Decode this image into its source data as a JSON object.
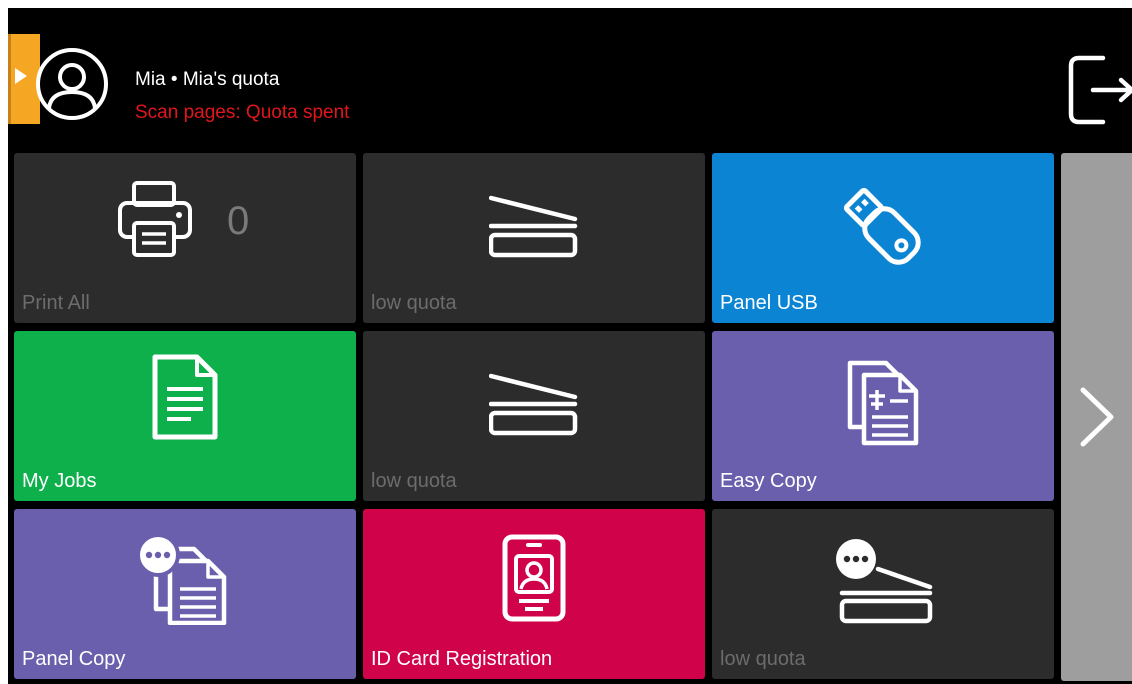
{
  "header": {
    "user_line": "Mia • Mia's quota",
    "quota_status": "Scan pages: Quota spent",
    "colors": {
      "quota_status": "#e0161b",
      "side_tab": "#f5a623"
    },
    "icons": {
      "side_tab": "chevron-right-icon",
      "avatar": "user-avatar-icon",
      "logout": "logout-icon"
    }
  },
  "tiles": [
    {
      "label": "Print All",
      "count": "0",
      "icon": "printer-icon",
      "color": "#2c2c2c",
      "enabled": false
    },
    {
      "label": "low quota",
      "icon": "scanner-icon",
      "color": "#2c2c2c",
      "enabled": false
    },
    {
      "label": "Panel USB",
      "icon": "usb-drive-icon",
      "color": "#0a84d3",
      "enabled": true
    },
    {
      "label": "My Jobs",
      "icon": "document-icon",
      "color": "#0db04b",
      "enabled": true
    },
    {
      "label": "low quota",
      "icon": "scanner-icon",
      "color": "#2c2c2c",
      "enabled": false
    },
    {
      "label": "Easy Copy",
      "icon": "copy-icon",
      "color": "#6a5fad",
      "enabled": true
    },
    {
      "label": "Panel Copy",
      "icon": "copy-options-icon",
      "color": "#6a5fad",
      "enabled": true
    },
    {
      "label": "ID Card Registration",
      "icon": "id-card-icon",
      "color": "#d0024a",
      "enabled": true
    },
    {
      "label": "low quota",
      "icon": "scanner-options-icon",
      "color": "#2c2c2c",
      "enabled": false
    }
  ],
  "navigation": {
    "next_icon": "chevron-right-icon"
  }
}
